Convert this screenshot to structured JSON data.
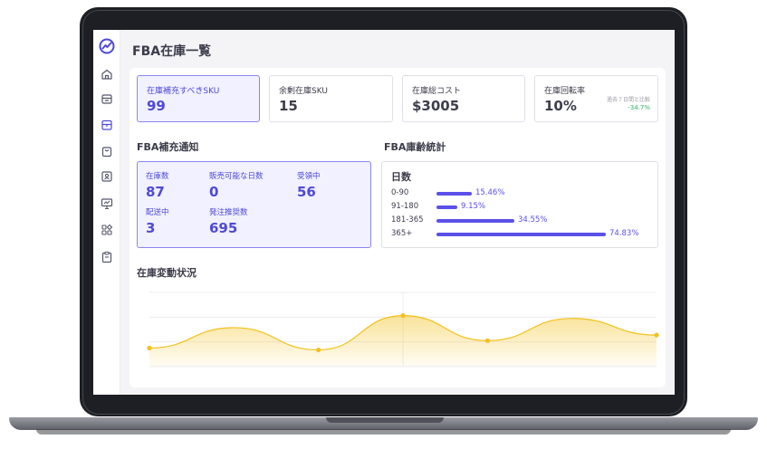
{
  "header": {
    "title": "FBA在庫一覧"
  },
  "sidebar": {
    "items": [
      {
        "icon": "home-icon"
      },
      {
        "icon": "store-icon"
      },
      {
        "icon": "box-icon"
      },
      {
        "icon": "bag-icon"
      },
      {
        "icon": "contact-card-icon"
      },
      {
        "icon": "presentation-chart-icon"
      },
      {
        "icon": "apps-icon"
      },
      {
        "icon": "clipboard-icon"
      }
    ]
  },
  "kpis": [
    {
      "label": "在庫補充すべきSKU",
      "value": "99",
      "active": true
    },
    {
      "label": "余剰在庫SKU",
      "value": "15"
    },
    {
      "label": "在庫総コスト",
      "value": "$3005"
    },
    {
      "label": "在庫回転率",
      "value": "10%",
      "compare_label": "過去７日間と比較",
      "compare_value": "-34.7%"
    }
  ],
  "replenishment": {
    "title": "FBA補充通知",
    "items": [
      {
        "label": "在庫数",
        "value": "87"
      },
      {
        "label": "販売可能な日数",
        "value": "0"
      },
      {
        "label": "受領中",
        "value": "56"
      },
      {
        "label": "配送中",
        "value": "3"
      },
      {
        "label": "発注推奨数",
        "value": "695"
      }
    ]
  },
  "aging": {
    "title": "FBA庫齢統計",
    "header": "日数",
    "rows": [
      {
        "range": "0-90",
        "percent_label": "15.46%",
        "fraction": 0.1546
      },
      {
        "range": "91-180",
        "percent_label": "9.15%",
        "fraction": 0.0915
      },
      {
        "range": "181-365",
        "percent_label": "34.55%",
        "fraction": 0.3455
      },
      {
        "range": "365+",
        "percent_label": "74.83%",
        "fraction": 0.7483
      }
    ]
  },
  "trend": {
    "title": "在庫変動状況"
  },
  "chart_data": {
    "type": "area",
    "x": [
      0,
      1,
      2,
      3,
      4,
      5
    ],
    "values": [
      20,
      42,
      18,
      55,
      28,
      52,
      34
    ],
    "points": [
      0,
      2,
      3,
      4,
      6
    ],
    "ylim": [
      0,
      80
    ],
    "color": "#f2c11c",
    "grid": true
  },
  "colors": {
    "accent": "#5b50e8",
    "positive": "#2fb36b",
    "chart": "#f2c11c"
  }
}
